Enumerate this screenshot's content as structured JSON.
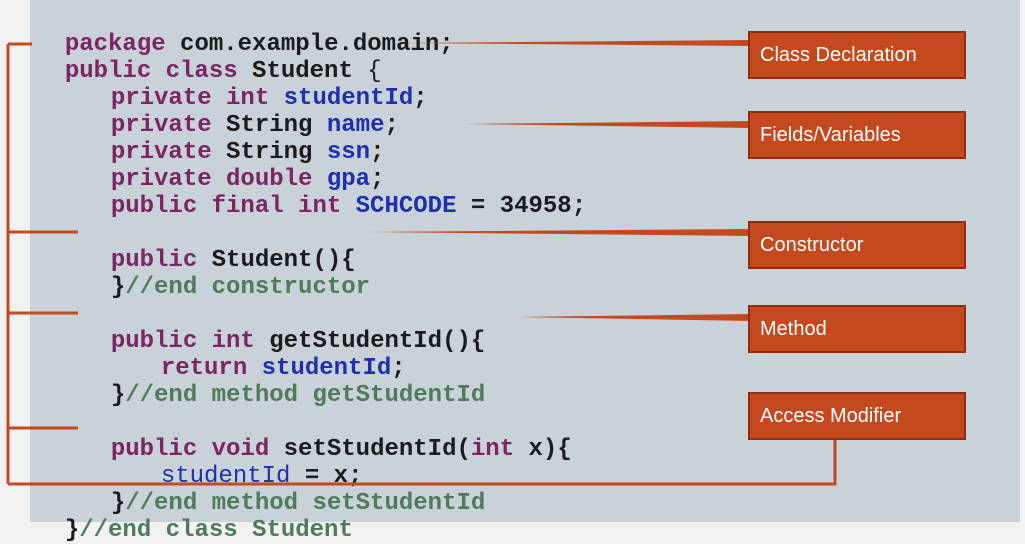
{
  "code": {
    "line1": {
      "kw": "package",
      "txt": " com.example.domain;"
    },
    "line2": {
      "kw": "public class",
      "txt": " Student ",
      "brace": "{"
    },
    "line3": {
      "kw": "private int",
      "fld": "studentId",
      "end": ";"
    },
    "line4": {
      "kw": "private",
      "txt": " String ",
      "fld": "name",
      "end": ";"
    },
    "line5": {
      "kw": "private",
      "txt": " String ",
      "fld": "ssn",
      "end": ";"
    },
    "line6": {
      "kw": "private double",
      "fld": "gpa",
      "end": ";"
    },
    "line7": {
      "kw": "public final int",
      "fld": "SCHCODE",
      "txt": " = 34958;"
    },
    "line8": {
      "kw": "public",
      "txt": " Student(){"
    },
    "line9": {
      "brace": "}",
      "cmt": "//end constructor"
    },
    "line10": {
      "kw": "public int",
      "txt": " getStudentId(){"
    },
    "line11": {
      "kw": "return",
      "fld": "studentId",
      "end": ";"
    },
    "line12": {
      "brace": "}",
      "cmt": "//end method getStudentId"
    },
    "line13": {
      "kw": "public void",
      "txt": " setStudentId(",
      "kw2": "int",
      "txt2": " x){"
    },
    "line14": {
      "fld": "studentId",
      "txt": " = x;"
    },
    "line15": {
      "brace": "}",
      "cmt": "//end method setStudentId"
    },
    "line16": {
      "brace": "}",
      "cmt": "//end class Student"
    }
  },
  "labels": {
    "class_declaration": "Class Declaration",
    "fields_variables": "Fields/Variables",
    "constructor": "Constructor",
    "method": "Method",
    "access_modifier": "Access Modifier"
  },
  "colors": {
    "keyword": "#7b2563",
    "field": "#1f2fb0",
    "comment": "#4f7a5c",
    "label_fill": "#c4491f",
    "connector": "#c4491f",
    "panel": "#c9d2d8"
  }
}
